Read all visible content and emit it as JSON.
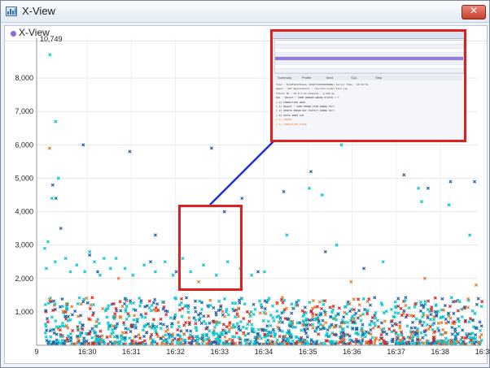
{
  "window": {
    "title": "X-View",
    "close_label": "✕"
  },
  "panel": {
    "title": "X-View"
  },
  "chart_data": {
    "type": "scatter",
    "title": "X-View",
    "max_label": "10,749",
    "y_ticks": [
      "1,000",
      "2,000",
      "3,000",
      "4,000",
      "5,000",
      "6,000",
      "7,000",
      "8,000"
    ],
    "y_tick_values": [
      1000,
      2000,
      3000,
      4000,
      5000,
      6000,
      7000,
      8000
    ],
    "x_ticks": [
      "9",
      "16:30",
      "16:31",
      "16:32",
      "16:33",
      "16:34",
      "16:35",
      "16:36",
      "16:37",
      "16:38",
      "16:39"
    ],
    "xlim": [
      "16:29",
      "16:39"
    ],
    "ylim": [
      0,
      9000
    ],
    "grid": true,
    "series": [
      {
        "color": "#00c6cc",
        "values": [
          [
            16.42,
            8700
          ],
          [
            16.78,
            6700
          ],
          [
            16.95,
            5000
          ],
          [
            16.55,
            4400
          ],
          [
            16.3,
            3100
          ],
          [
            16.1,
            2900
          ],
          [
            16.2,
            2300
          ],
          [
            16.75,
            2500
          ],
          [
            17.4,
            2600
          ],
          [
            17.7,
            2200
          ],
          [
            18.1,
            2400
          ],
          [
            18.6,
            2200
          ],
          [
            18.9,
            2800
          ],
          [
            19.2,
            2500
          ],
          [
            19.55,
            2100
          ],
          [
            19.8,
            2600
          ],
          [
            20.2,
            2300
          ],
          [
            20.55,
            2600
          ],
          [
            21.1,
            2300
          ],
          [
            21.6,
            2100
          ],
          [
            22.3,
            2400
          ],
          [
            23.0,
            2200
          ],
          [
            23.6,
            2500
          ],
          [
            24.1,
            2100
          ],
          [
            24.7,
            2600
          ],
          [
            25.2,
            2200
          ],
          [
            26.0,
            2400
          ],
          [
            26.8,
            2100
          ],
          [
            27.5,
            2500
          ],
          [
            28.3,
            2300
          ],
          [
            29.0,
            2100
          ],
          [
            29.8,
            2200
          ],
          [
            31.2,
            3300
          ],
          [
            32.9,
            7700
          ],
          [
            34.0,
            7600
          ],
          [
            32.6,
            4700
          ],
          [
            34.6,
            6000
          ],
          [
            36.8,
            6200
          ],
          [
            39.4,
            4700
          ],
          [
            39.6,
            4300
          ],
          [
            41.3,
            4200
          ],
          [
            42.6,
            3300
          ],
          [
            34.3,
            3000
          ],
          [
            33.4,
            4500
          ],
          [
            37.2,
            2500
          ]
        ]
      },
      {
        "color": "#1f5fa8",
        "values": [
          [
            16.6,
            4800
          ],
          [
            16.8,
            4400
          ],
          [
            17.1,
            3500
          ],
          [
            18.5,
            6000
          ],
          [
            18.9,
            2700
          ],
          [
            19.4,
            2200
          ],
          [
            21.4,
            5800
          ],
          [
            23.0,
            3300
          ],
          [
            26.5,
            5900
          ],
          [
            27.3,
            4000
          ],
          [
            28.4,
            4400
          ],
          [
            31.0,
            4600
          ],
          [
            32.7,
            5200
          ],
          [
            38.5,
            5100
          ],
          [
            40.0,
            4700
          ],
          [
            41.4,
            4900
          ],
          [
            42.9,
            4900
          ],
          [
            22.7,
            2500
          ],
          [
            24.3,
            2200
          ],
          [
            29.4,
            2200
          ],
          [
            36.0,
            2300
          ],
          [
            33.6,
            2800
          ]
        ]
      },
      {
        "color": "#e8772a",
        "values": [
          [
            16.4,
            5900
          ],
          [
            20.7,
            2000
          ],
          [
            25.7,
            1900
          ],
          [
            35.2,
            1900
          ],
          [
            39.8,
            2000
          ],
          [
            43.0,
            1800
          ]
        ]
      },
      {
        "color": "#e0201c",
        "values": [
          [
            22.4,
            10600
          ],
          [
            16.3,
            700
          ],
          [
            19.1,
            900
          ],
          [
            21.5,
            600
          ],
          [
            24.7,
            1100
          ],
          [
            28.5,
            800
          ],
          [
            31.1,
            800
          ],
          [
            35.3,
            700
          ],
          [
            38.7,
            900
          ],
          [
            41.6,
            700
          ]
        ]
      }
    ]
  },
  "detail_thumbnail": {
    "tabs": [
      "Summary",
      "Profile",
      "Bind",
      "SQL",
      "Step"
    ],
    "lines": [
      "Txid : 7b78f1b5f0ea1a  (ACE7C7A940A6B8B8)   Server Time : 16:32:51",
      "Agent : 007    Application : /service/order/list.jsp",
      "Client IP : 10.0.4.21    Elapsed : 2,140 ms",
      "SQL : SELECT * FROM ORDERS WHERE STATUS = ?",
      "[ 0] CONNECTION OPEN",
      "[ 1] SELECT * FROM ORDER_ITEM WHERE ID=?",
      "[ 2] UPDATE ORDER SET STATE=? WHERE ID=?",
      "[ 3] FETCH ROWS 120",
      "[ 4] COMMIT",
      "[ 5] CONNECTION CLOSE"
    ]
  }
}
